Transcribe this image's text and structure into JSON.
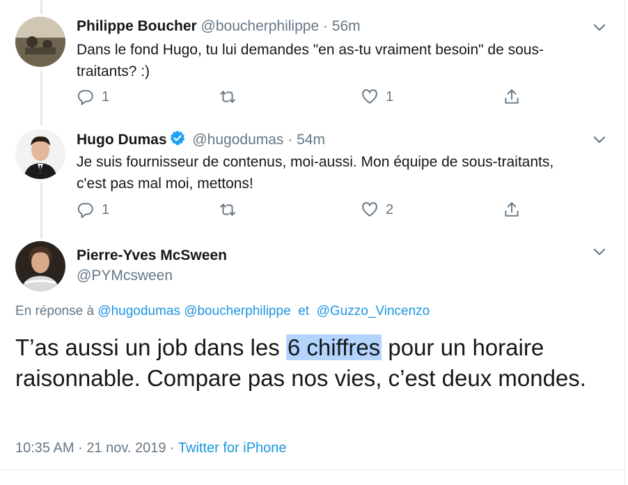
{
  "tweets": [
    {
      "name": "Philippe Boucher",
      "handle": "@boucherphilippe",
      "separator": "·",
      "time": "56m",
      "text": "Dans le fond Hugo, tu lui demandes \"en as-tu vraiment besoin\" de sous-traitants? :)",
      "replies": "1",
      "retweets": "",
      "likes": "1",
      "verified": false
    },
    {
      "name": "Hugo Dumas",
      "handle": "@hugodumas",
      "separator": "·",
      "time": "54m",
      "text": "Je suis fournisseur de contenus, moi-aussi. Mon équipe de sous-traitants, c'est pas mal moi, mettons!",
      "replies": "1",
      "retweets": "",
      "likes": "2",
      "verified": true
    }
  ],
  "main_tweet": {
    "name": "Pierre-Yves McSween",
    "handle": "@PYMcsween",
    "reply_prefix": "En réponse à",
    "reply_to_1": "@hugodumas",
    "reply_to_2": "@boucherphilippe",
    "reply_and": "et",
    "reply_to_3": "@Guzzo_Vincenzo",
    "text_before": "T’as aussi un job dans les",
    "text_highlight": "6 chiffres",
    "text_after": "pour un horaire raisonnable. Compare pas nos  vies, c’est deux mondes.",
    "time": "10:35 AM",
    "date": "21 nov. 2019",
    "separator": "·",
    "source": "Twitter for iPhone"
  },
  "colors": {
    "link": "#1b95e0",
    "muted": "#657786",
    "text": "#14171a",
    "highlight": "#b3d4fd",
    "verified": "#1da1f2"
  }
}
